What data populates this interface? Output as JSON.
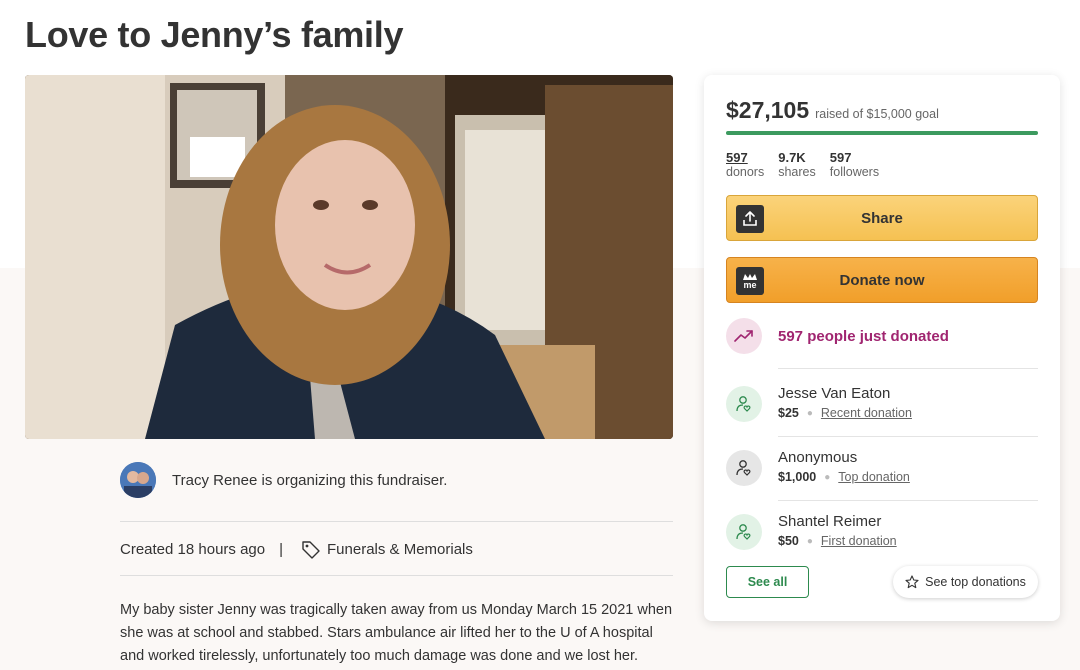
{
  "page": {
    "title": "Love to Jenny’s family"
  },
  "photo": {
    "alt": "Fundraiser photo"
  },
  "organizer": {
    "text": "Tracy Renee is organizing this fundraiser."
  },
  "meta": {
    "created": "Created 18 hours ago",
    "separator": "|",
    "category": "Funerals & Memorials"
  },
  "story": {
    "text": "My baby sister Jenny was tragically taken away from us Monday March 15 2021 when she was at school and stabbed. Stars ambulance air lifted her to the U of A hospital and worked tirelessly, unfortunately too much damage was done and we lost her."
  },
  "card": {
    "raised_amount": "$27,105",
    "raised_goal": "raised of $15,000 goal",
    "progress_fraction": 1.0,
    "stats": [
      {
        "num": "597",
        "label": "donors"
      },
      {
        "num": "9.7K",
        "label": "shares"
      },
      {
        "num": "597",
        "label": "followers"
      }
    ],
    "share_label": "Share",
    "donate_label": "Donate now",
    "donate_icon_text": "me",
    "trend_text": "597 people just donated",
    "donations": [
      {
        "name": "Jesse Van Eaton",
        "amount": "$25",
        "type": "Recent donation"
      },
      {
        "name": "Anonymous",
        "amount": "$1,000",
        "type": "Top donation"
      },
      {
        "name": "Shantel Reimer",
        "amount": "$50",
        "type": "First donation"
      }
    ],
    "see_all_label": "See all",
    "see_top_label": "See top donations"
  },
  "colors": {
    "accent_green": "#3c9a5f",
    "share_yellow": "#f5c152",
    "donate_orange": "#f19f2a",
    "trend_purple": "#a02570"
  },
  "icons": {
    "share": "share-upload-icon",
    "donate": "gofundme-me-icon",
    "trend": "trending-up-icon",
    "donor": "donor-heart-icon",
    "tag": "tag-icon",
    "star": "star-icon"
  }
}
